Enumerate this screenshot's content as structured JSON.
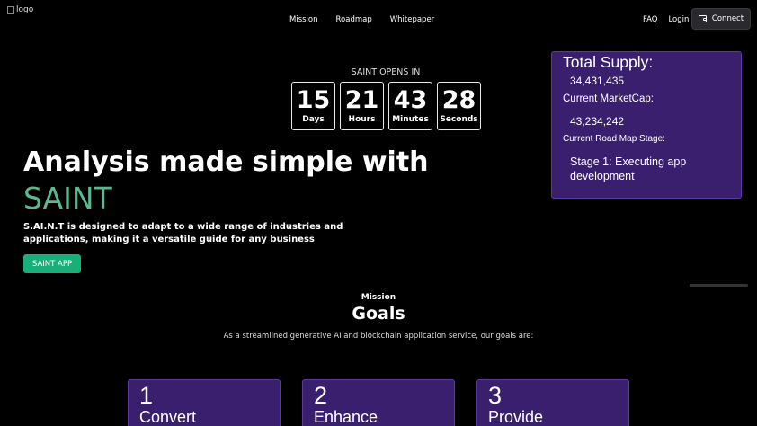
{
  "header": {
    "logo_alt": "logo",
    "nav": [
      "Mission",
      "Roadmap",
      "Whitepaper"
    ],
    "right_links": [
      "FAQ",
      "Login"
    ],
    "connect_label": "Connect"
  },
  "countdown": {
    "label": "SAINT OPENS IN",
    "units": [
      {
        "value": "15",
        "unit": "Days"
      },
      {
        "value": "21",
        "unit": "Hours"
      },
      {
        "value": "43",
        "unit": "Minutes"
      },
      {
        "value": "28",
        "unit": "Seconds"
      }
    ]
  },
  "stats": {
    "total_supply_label": "Total Supply:",
    "total_supply_value": "34,431,435",
    "marketcap_label": "Current MarketCap:",
    "marketcap_value": "43,234,242",
    "stage_label": "Current Road Map Stage:",
    "stage_value": "Stage 1: Executing app development"
  },
  "hero": {
    "title": "Analysis made simple with",
    "accent": "SAINT",
    "accent_color": "#5cb88f",
    "description": "S.AI.N.T is designed to adapt to a wide range of industries and applications, making it a versatile guide for any business",
    "button_label": "SAINT APP",
    "button_color": "#18b07a"
  },
  "goals": {
    "section_label": "Mission",
    "heading": "Goals",
    "subtitle": "As a streamlined generative AI and blockchain application service, our goals are:",
    "cards": [
      {
        "number": "1",
        "title": "Convert"
      },
      {
        "number": "2",
        "title": "Enhance"
      },
      {
        "number": "3",
        "title": "Provide"
      }
    ],
    "card_color": "#3a1f6e"
  }
}
